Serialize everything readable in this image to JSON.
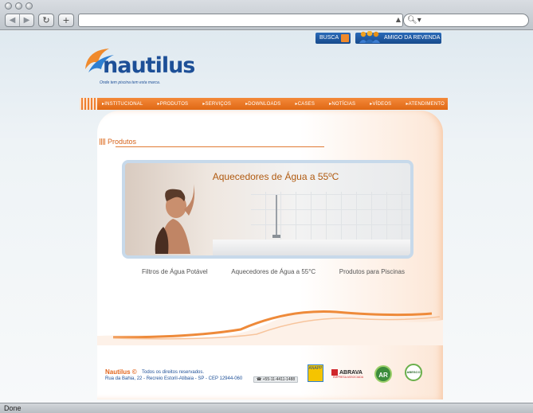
{
  "browser": {
    "nav_back": "◀",
    "nav_forward": "▶",
    "reload": "↻",
    "add": "+",
    "url": "",
    "search_icon": "🔍︎▾",
    "status": "Done"
  },
  "header": {
    "busca_label": "BUSCA",
    "amigo_label": "AMIGO DA REVENDA",
    "logo_text": "nautilus",
    "logo_tagline": "Onde tem piscina tem esta marca."
  },
  "nav": {
    "items": [
      "INSTITUCIONAL",
      "PRODUTOS",
      "SERVIÇOS",
      "DOWNLOADS",
      "CASES",
      "NOTÍCIAS",
      "VÍDEOS",
      "ATENDIMENTO"
    ]
  },
  "main": {
    "section_title": "Produtos",
    "banner_title": "Aquecedores de Água a 55ºC",
    "links": [
      "Filtros de Água Potável",
      "Aquecedores de Água a 55°C",
      "Produtos para Piscinas"
    ]
  },
  "footer": {
    "brand": "Nautilus ©",
    "rights": "Todos os direitos reservados.",
    "address": "Rua da Bahia, 22 - Recreio Estoril-Atibaia - SP - CEP 12944-060",
    "phone": "+55-11-4411-1488",
    "partners": [
      "ANAPP",
      "ABRAVA",
      "AR",
      "ABESCO"
    ],
    "abrava_sub": "EMPRESA ASSOCIADA"
  },
  "colors": {
    "accent": "#e8731f",
    "brand_blue": "#1d4f97"
  }
}
